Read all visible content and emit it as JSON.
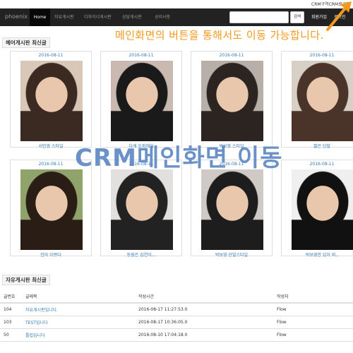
{
  "top_link": "CRM구역CRM로그인",
  "nav": {
    "brand": "phoenix",
    "items": [
      "Home",
      "자유게시판",
      "디자이너게시판",
      "상담게시판",
      "공지사항"
    ],
    "search_button": "검색",
    "right_items": [
      "회원가입",
      "로그인"
    ]
  },
  "notes": {
    "orange": "메인화면의 버튼을 통해서도 이동 가능합니다.",
    "blue": "CRM메인화면 이동"
  },
  "hair_board": {
    "title": "헤어게시판 최신글",
    "cards": [
      {
        "date": "2016-08-11",
        "caption": "서인영 스타일"
      },
      {
        "date": "2016-08-11",
        "caption": "다캐 오퍼헤어"
      },
      {
        "date": "2016-08-11",
        "caption": "박보영 스타일"
      },
      {
        "date": "2016-08-11",
        "caption": "짧은 단발"
      },
      {
        "date": "2016-08-11",
        "caption": "민아 이쁘다"
      },
      {
        "date": "2016-08-11",
        "caption": "동원은 김연아..."
      },
      {
        "date": "2016-08-11",
        "caption": "박보영 단발스타일"
      },
      {
        "date": "2016-08-11",
        "caption": "박보영만 있어 외.."
      }
    ]
  },
  "free_board": {
    "title": "자유게시판 최신글",
    "headers": [
      "글번호",
      "글제목",
      "작성시간",
      "작성자"
    ],
    "rows": [
      {
        "no": "104",
        "title": "자유게시판입니다.",
        "time": "2016-08-17 11:27:53.0",
        "author": "Flow"
      },
      {
        "no": "103",
        "title": "TEST입니다",
        "time": "2016-08-17 10:36:05.0",
        "author": "Flow"
      },
      {
        "no": "50",
        "title": "틀립입니다",
        "time": "2016-08-10 17:04:18.0",
        "author": "Flow"
      }
    ]
  },
  "colors": {
    "nav_bg": "#222222",
    "link": "#337ab7",
    "orange_note": "#f39a1d",
    "blue_note": "#5b87c3"
  }
}
